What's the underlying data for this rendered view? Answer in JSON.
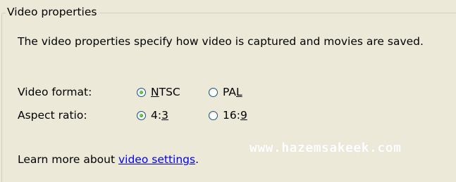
{
  "group": {
    "title": "Video properties",
    "description": "The video properties specify how video is captured and movies are saved."
  },
  "video_format": {
    "label": "Video format:",
    "options": [
      {
        "label": "NTSC",
        "checked": true
      },
      {
        "label": "PAL",
        "checked": false
      }
    ]
  },
  "aspect_ratio": {
    "label": "Aspect ratio:",
    "options": [
      {
        "label": "4:3",
        "checked": true
      },
      {
        "label": "16:9",
        "checked": false
      }
    ]
  },
  "learn_more": {
    "prefix": "Learn more about ",
    "link": "video settings",
    "suffix": "."
  },
  "watermark": "www.hazemsakeek.com",
  "colors": {
    "background": "#ece9d8",
    "link": "#0000ee",
    "radio_dot": "#21a121"
  }
}
